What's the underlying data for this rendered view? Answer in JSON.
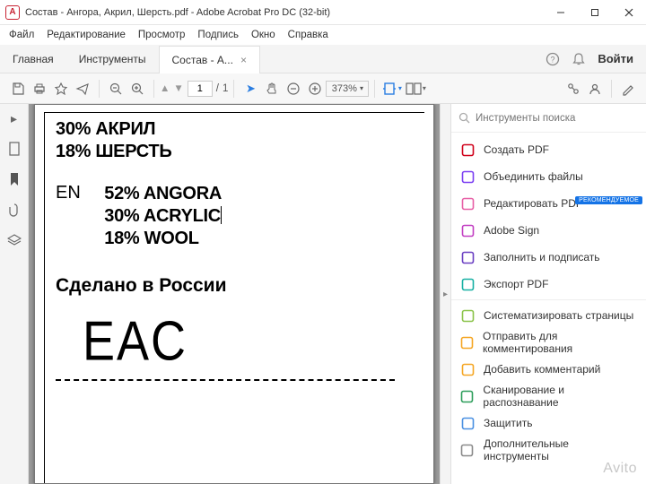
{
  "window": {
    "title": "Состав - Ангора, Акрил, Шерсть.pdf - Adobe Acrobat Pro DC (32-bit)",
    "app_badge": "A"
  },
  "menu": [
    "Файл",
    "Редактирование",
    "Просмотр",
    "Подпись",
    "Окно",
    "Справка"
  ],
  "strip": {
    "home": "Главная",
    "tools": "Инструменты",
    "doc_tab": "Состав - А...",
    "signin": "Войти"
  },
  "toolbar": {
    "page_current": "1",
    "page_sep": "/",
    "page_total": "1",
    "zoom": "373%",
    "zoom_caret": "▾"
  },
  "document": {
    "ru_lines": [
      "30% АКРИЛ",
      "18% ШЕРСТЬ"
    ],
    "en_label": "EN",
    "en_lines": [
      "52% ANGORA",
      "30% ACRYLIC",
      "18% WOOL"
    ],
    "made_in": "Сделано в России",
    "eac": "EAC"
  },
  "right_panel": {
    "search_placeholder": "Инструменты поиска",
    "badge": "РЕКОМЕНДУЕМОЕ",
    "items": [
      {
        "label": "Создать PDF",
        "color": "#d0021b"
      },
      {
        "label": "Объединить файлы",
        "color": "#7b3ff2"
      },
      {
        "label": "Редактировать PDF",
        "color": "#e75fa6",
        "badge": true
      },
      {
        "label": "Adobe Sign",
        "color": "#c23fc2"
      },
      {
        "label": "Заполнить и подписать",
        "color": "#6a3fc2"
      },
      {
        "label": "Экспорт PDF",
        "color": "#17b0a3"
      },
      {
        "label": "Систематизировать страницы",
        "color": "#8bc34a"
      },
      {
        "label": "Отправить для комментирования",
        "color": "#f5a623"
      },
      {
        "label": "Добавить комментарий",
        "color": "#f5a623"
      },
      {
        "label": "Сканирование и распознавание",
        "color": "#2e9e5b"
      },
      {
        "label": "Защитить",
        "color": "#4a90e2"
      },
      {
        "label": "Дополнительные инструменты",
        "color": "#8a8a8a"
      }
    ]
  },
  "watermark": "Avito"
}
